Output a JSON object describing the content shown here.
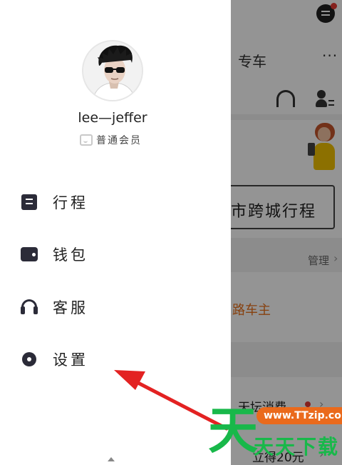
{
  "drawer": {
    "username": "lee—jeffer",
    "member_level": "普通会员",
    "menu": [
      {
        "label": "行程",
        "icon": "trip-list-icon"
      },
      {
        "label": "钱包",
        "icon": "wallet-icon"
      },
      {
        "label": "客服",
        "icon": "headset-icon"
      },
      {
        "label": "设置",
        "icon": "gear-icon"
      }
    ]
  },
  "background": {
    "tab_label": "专车",
    "more_label": "···",
    "intercity_button": "市跨城行程",
    "manage_label": "管理",
    "owner_text": "路车主",
    "consume_text": "天坛消费",
    "earn_text": "立得20元"
  },
  "watermark": {
    "big_char": "天",
    "url": "www.TTzip.com",
    "site_name": "天天下载"
  },
  "colors": {
    "accent": "#e8701a",
    "annotation_arrow": "#e32222",
    "watermark_green": "#18b84a"
  }
}
